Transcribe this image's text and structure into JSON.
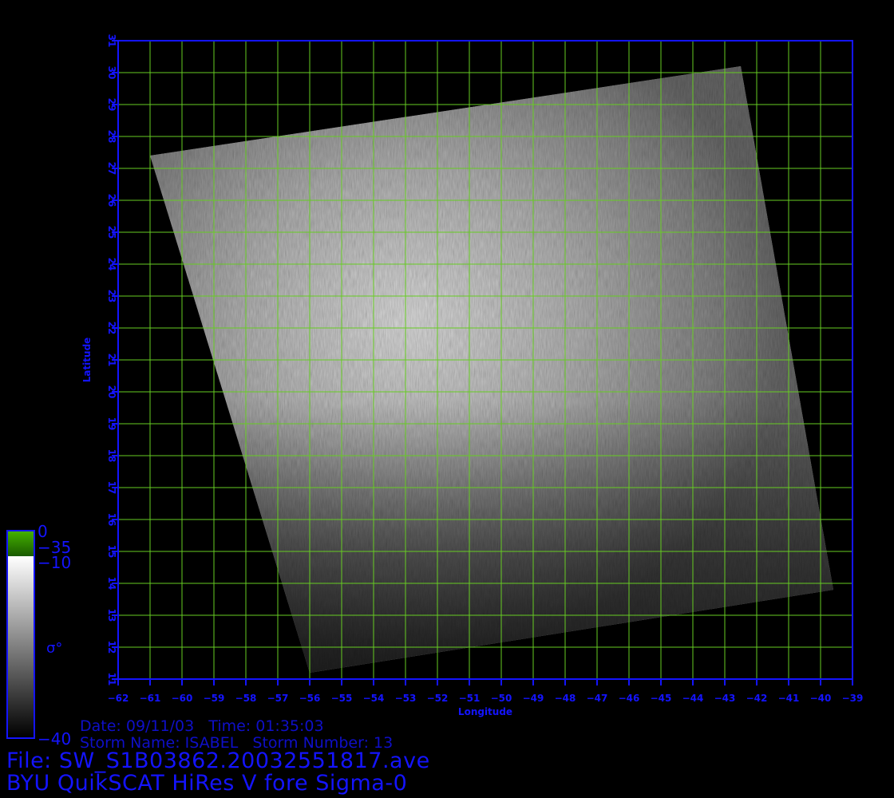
{
  "map": {
    "lon_range": [
      -62,
      -39
    ],
    "lat_range": [
      11,
      31
    ],
    "lon_ticks": [
      -62,
      -61,
      -60,
      -59,
      -58,
      -57,
      -56,
      -55,
      -54,
      -53,
      -52,
      -51,
      -50,
      -49,
      -48,
      -47,
      -46,
      -45,
      -44,
      -43,
      -42,
      -41,
      -40,
      -39
    ],
    "lat_ticks": [
      11,
      12,
      13,
      14,
      15,
      16,
      17,
      18,
      19,
      20,
      21,
      22,
      23,
      24,
      25,
      26,
      27,
      28,
      29,
      30,
      31
    ],
    "xlabel": "Longitude",
    "ylabel": "Latitude",
    "grid": true,
    "grid_color": "#66cc22",
    "frame_color": "#1414ff",
    "swath_corners_lonlat": [
      [
        -61.0,
        27.4
      ],
      [
        -42.5,
        30.2
      ],
      [
        -39.6,
        13.8
      ],
      [
        -56.0,
        11.2
      ]
    ]
  },
  "colorbar": {
    "label_0": "0",
    "label_35": "−35",
    "label_10": "−10",
    "label_40": "−40",
    "sigma_label": "σ°",
    "top_color": "#2e8a00",
    "frame_color": "#1414ff"
  },
  "info": {
    "date_line": "Date: 09/11/03   Time: 01:35:03",
    "storm_line": "Storm Name: ISABEL   Storm Number: 13",
    "file_line": "File: SW_S1B03862.20032551817.ave",
    "title_line": "BYU QuikSCAT HiRes V fore Sigma-0"
  }
}
